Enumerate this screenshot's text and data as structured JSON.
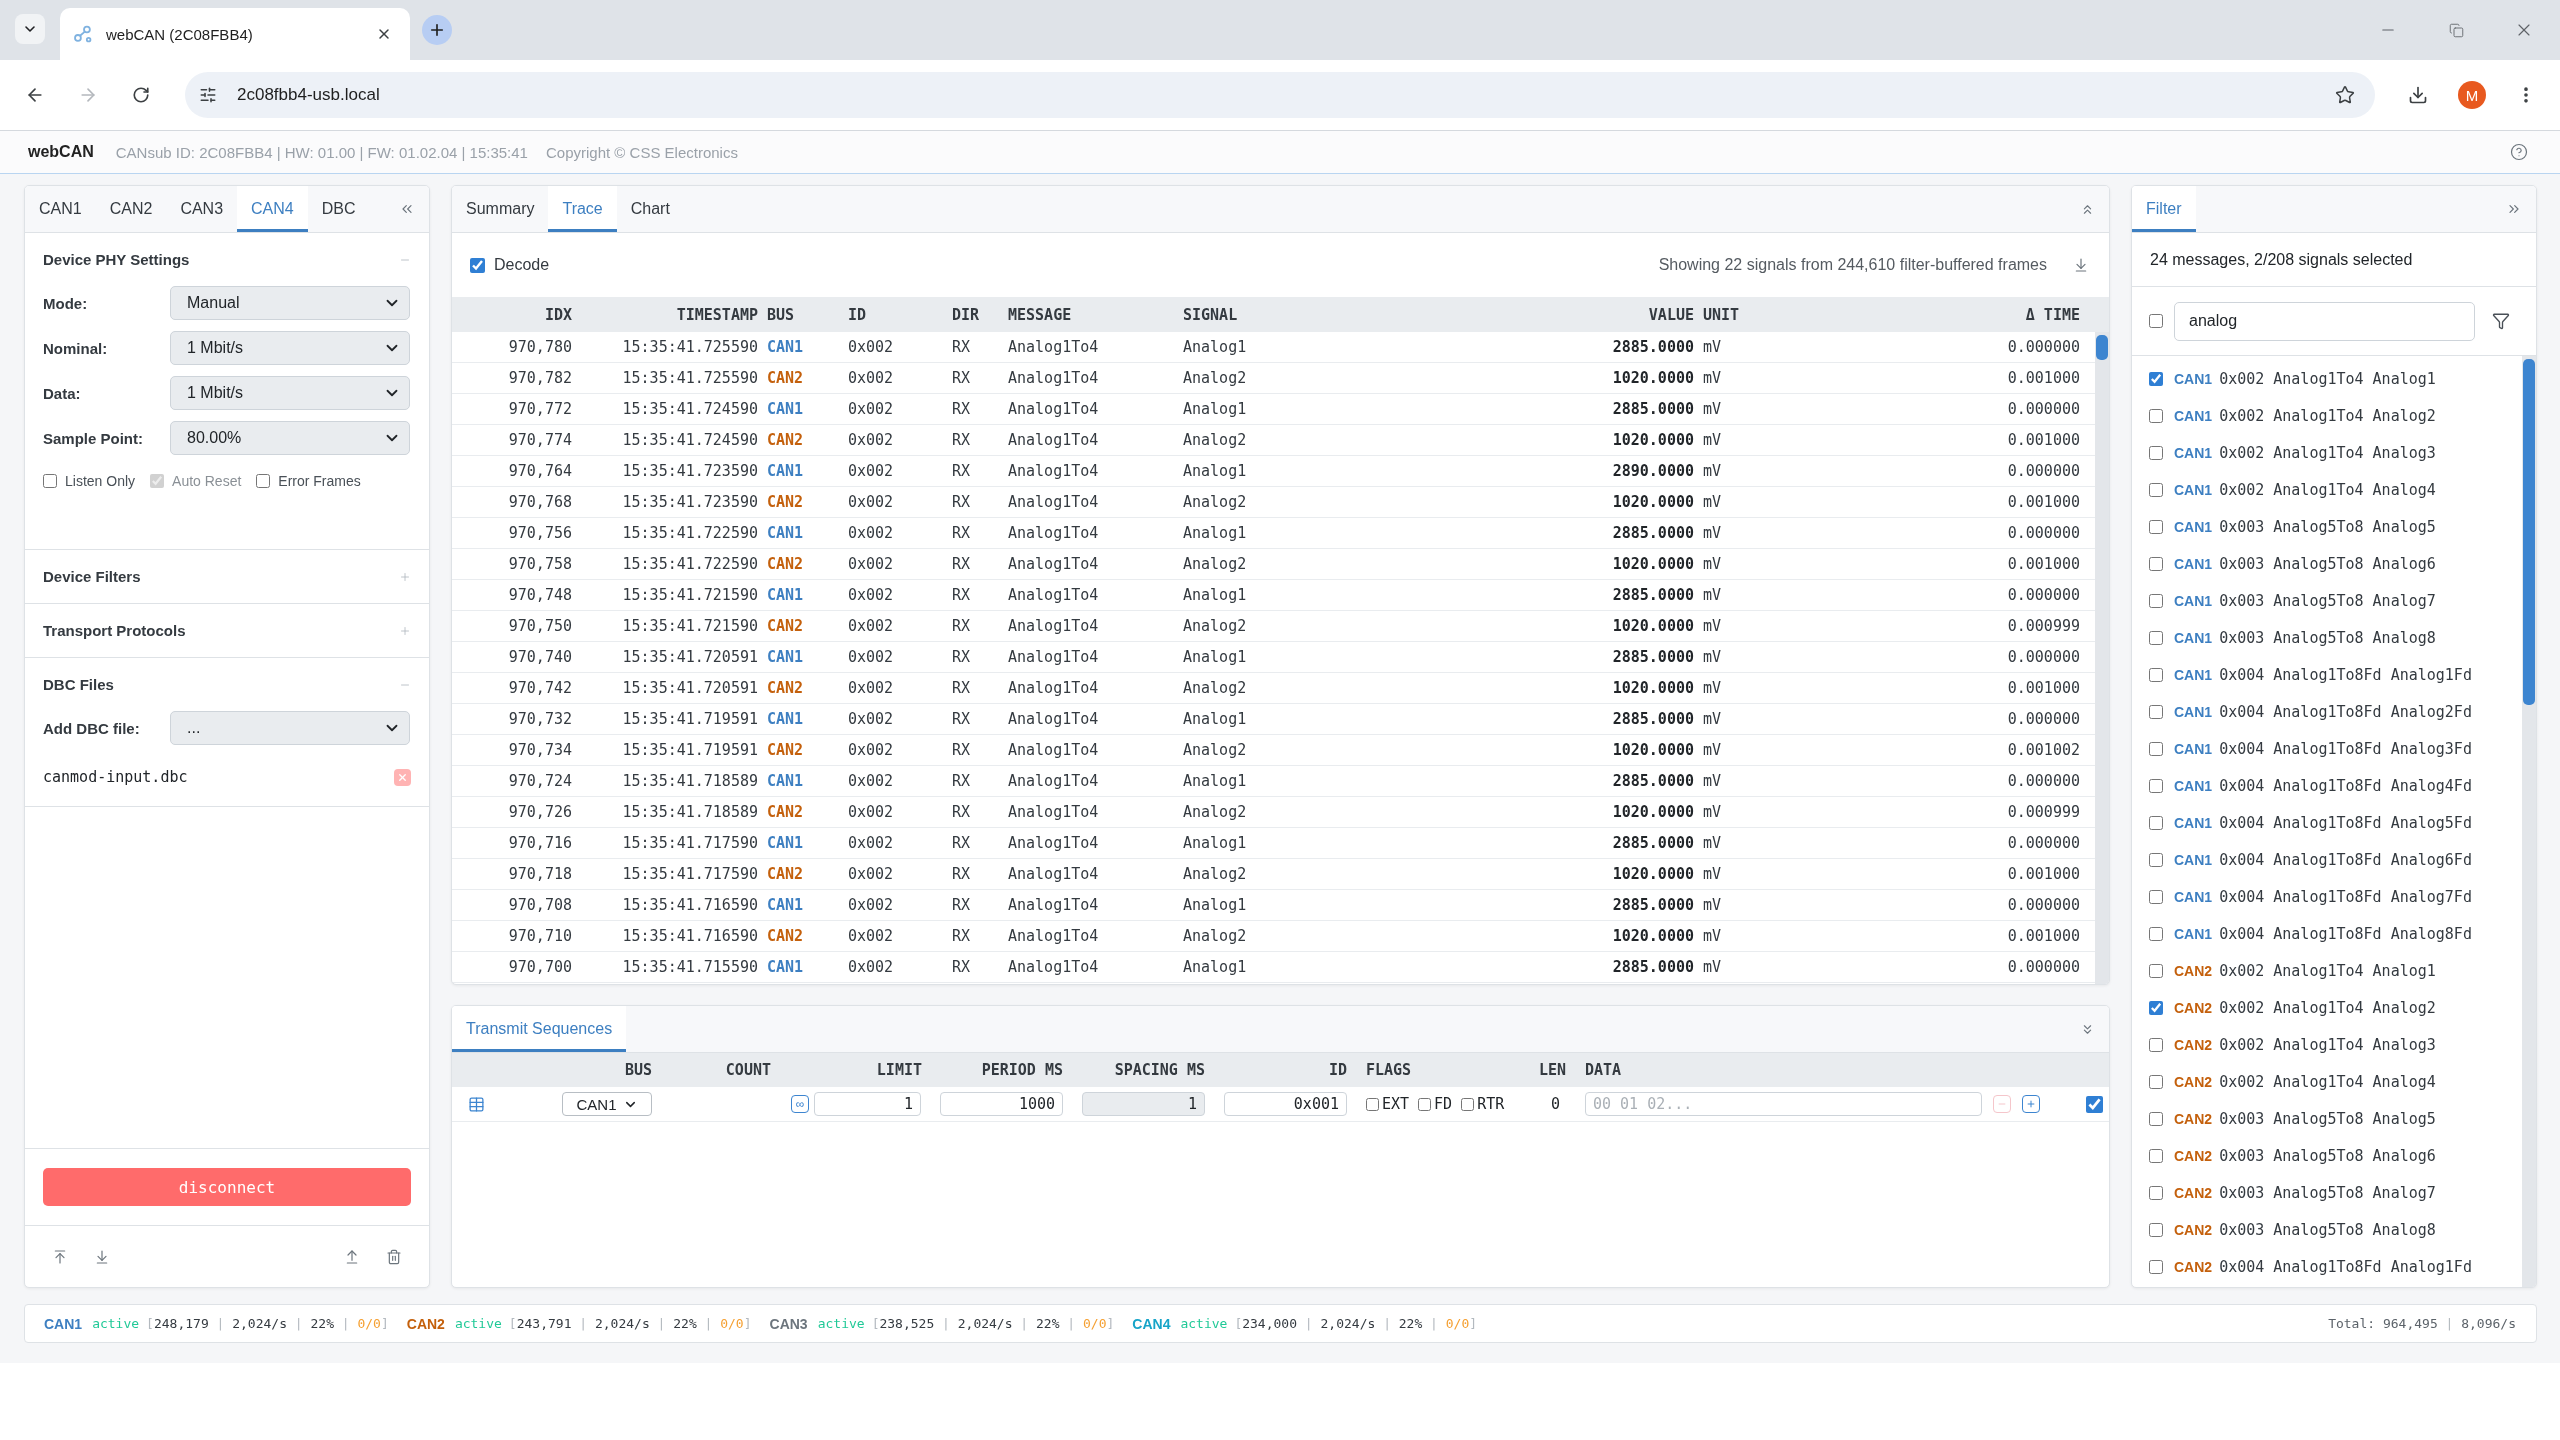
{
  "browser": {
    "tab_title": "webCAN (2C08FBB4)",
    "address": "2c08fbb4-usb.local",
    "profile_initial": "M"
  },
  "app_header": {
    "app_name": "webCAN",
    "device_info": "CANsub ID: 2C08FBB4 | HW: 01.00 | FW: 01.02.04 | 15:35:41",
    "copyright": "Copyright © CSS Electronics"
  },
  "device_panel": {
    "tabs": [
      {
        "label": "CAN1",
        "selected": false
      },
      {
        "label": "CAN2",
        "selected": false
      },
      {
        "label": "CAN3",
        "selected": false
      },
      {
        "label": "CAN4",
        "selected": true
      },
      {
        "label": "DBC",
        "selected": false
      }
    ],
    "sections": [
      {
        "title": "Device PHY Settings",
        "expanded": true,
        "fields": [
          {
            "label": "Mode:",
            "value": "Manual"
          },
          {
            "label": "Nominal:",
            "value": "1 Mbit/s"
          },
          {
            "label": "Data:",
            "value": "1 Mbit/s"
          },
          {
            "label": "Sample Point:",
            "value": "80.00%"
          }
        ],
        "options": [
          {
            "label": "Listen Only",
            "checked": false,
            "disabled": false
          },
          {
            "label": "Auto Reset",
            "checked": true,
            "disabled": true
          },
          {
            "label": "Error Frames",
            "checked": false,
            "disabled": false
          }
        ]
      },
      {
        "title": "Device Filters",
        "expanded": false
      },
      {
        "title": "Transport Protocols",
        "expanded": false
      },
      {
        "title": "DBC Files",
        "expanded": true,
        "fields": [
          {
            "label": "Add DBC file:",
            "value": "..."
          }
        ],
        "files": [
          "canmod-input.dbc"
        ]
      }
    ],
    "disconnect_button": "disconnect"
  },
  "trace_panel": {
    "tabs": [
      {
        "label": "Summary",
        "selected": false
      },
      {
        "label": "Trace",
        "selected": true
      },
      {
        "label": "Chart",
        "selected": false
      }
    ],
    "decode": {
      "label": "Decode",
      "checked": true
    },
    "summary": "Showing 22 signals from 244,610 filter-buffered frames",
    "columns": [
      "IDX",
      "TIMESTAMP",
      "BUS",
      "ID",
      "DIR",
      "MESSAGE",
      "SIGNAL",
      "VALUE",
      "UNIT",
      "Δ TIME"
    ],
    "rows": [
      {
        "idx": "970,780",
        "timestamp": "15:35:41.725590",
        "bus": {
          "label": "CAN1",
          "color": "#3d7fc1"
        },
        "id": "0x002",
        "dir": "RX",
        "message": "Analog1To4",
        "signal": "Analog1",
        "value": "2885.0000",
        "unit": "mV",
        "delta_time": "0.000000"
      },
      {
        "idx": "970,782",
        "timestamp": "15:35:41.725590",
        "bus": {
          "label": "CAN2",
          "color": "#c4600c"
        },
        "id": "0x002",
        "dir": "RX",
        "message": "Analog1To4",
        "signal": "Analog2",
        "value": "1020.0000",
        "unit": "mV",
        "delta_time": "0.001000"
      },
      {
        "idx": "970,772",
        "timestamp": "15:35:41.724590",
        "bus": {
          "label": "CAN1",
          "color": "#3d7fc1"
        },
        "id": "0x002",
        "dir": "RX",
        "message": "Analog1To4",
        "signal": "Analog1",
        "value": "2885.0000",
        "unit": "mV",
        "delta_time": "0.000000"
      },
      {
        "idx": "970,774",
        "timestamp": "15:35:41.724590",
        "bus": {
          "label": "CAN2",
          "color": "#c4600c"
        },
        "id": "0x002",
        "dir": "RX",
        "message": "Analog1To4",
        "signal": "Analog2",
        "value": "1020.0000",
        "unit": "mV",
        "delta_time": "0.001000"
      },
      {
        "idx": "970,764",
        "timestamp": "15:35:41.723590",
        "bus": {
          "label": "CAN1",
          "color": "#3d7fc1"
        },
        "id": "0x002",
        "dir": "RX",
        "message": "Analog1To4",
        "signal": "Analog1",
        "value": "2890.0000",
        "unit": "mV",
        "delta_time": "0.000000"
      },
      {
        "idx": "970,768",
        "timestamp": "15:35:41.723590",
        "bus": {
          "label": "CAN2",
          "color": "#c4600c"
        },
        "id": "0x002",
        "dir": "RX",
        "message": "Analog1To4",
        "signal": "Analog2",
        "value": "1020.0000",
        "unit": "mV",
        "delta_time": "0.001000"
      },
      {
        "idx": "970,756",
        "timestamp": "15:35:41.722590",
        "bus": {
          "label": "CAN1",
          "color": "#3d7fc1"
        },
        "id": "0x002",
        "dir": "RX",
        "message": "Analog1To4",
        "signal": "Analog1",
        "value": "2885.0000",
        "unit": "mV",
        "delta_time": "0.000000"
      },
      {
        "idx": "970,758",
        "timestamp": "15:35:41.722590",
        "bus": {
          "label": "CAN2",
          "color": "#c4600c"
        },
        "id": "0x002",
        "dir": "RX",
        "message": "Analog1To4",
        "signal": "Analog2",
        "value": "1020.0000",
        "unit": "mV",
        "delta_time": "0.001000"
      },
      {
        "idx": "970,748",
        "timestamp": "15:35:41.721590",
        "bus": {
          "label": "CAN1",
          "color": "#3d7fc1"
        },
        "id": "0x002",
        "dir": "RX",
        "message": "Analog1To4",
        "signal": "Analog1",
        "value": "2885.0000",
        "unit": "mV",
        "delta_time": "0.000000"
      },
      {
        "idx": "970,750",
        "timestamp": "15:35:41.721590",
        "bus": {
          "label": "CAN2",
          "color": "#c4600c"
        },
        "id": "0x002",
        "dir": "RX",
        "message": "Analog1To4",
        "signal": "Analog2",
        "value": "1020.0000",
        "unit": "mV",
        "delta_time": "0.000999"
      },
      {
        "idx": "970,740",
        "timestamp": "15:35:41.720591",
        "bus": {
          "label": "CAN1",
          "color": "#3d7fc1"
        },
        "id": "0x002",
        "dir": "RX",
        "message": "Analog1To4",
        "signal": "Analog1",
        "value": "2885.0000",
        "unit": "mV",
        "delta_time": "0.000000"
      },
      {
        "idx": "970,742",
        "timestamp": "15:35:41.720591",
        "bus": {
          "label": "CAN2",
          "color": "#c4600c"
        },
        "id": "0x002",
        "dir": "RX",
        "message": "Analog1To4",
        "signal": "Analog2",
        "value": "1020.0000",
        "unit": "mV",
        "delta_time": "0.001000"
      },
      {
        "idx": "970,732",
        "timestamp": "15:35:41.719591",
        "bus": {
          "label": "CAN1",
          "color": "#3d7fc1"
        },
        "id": "0x002",
        "dir": "RX",
        "message": "Analog1To4",
        "signal": "Analog1",
        "value": "2885.0000",
        "unit": "mV",
        "delta_time": "0.000000"
      },
      {
        "idx": "970,734",
        "timestamp": "15:35:41.719591",
        "bus": {
          "label": "CAN2",
          "color": "#c4600c"
        },
        "id": "0x002",
        "dir": "RX",
        "message": "Analog1To4",
        "signal": "Analog2",
        "value": "1020.0000",
        "unit": "mV",
        "delta_time": "0.001002"
      },
      {
        "idx": "970,724",
        "timestamp": "15:35:41.718589",
        "bus": {
          "label": "CAN1",
          "color": "#3d7fc1"
        },
        "id": "0x002",
        "dir": "RX",
        "message": "Analog1To4",
        "signal": "Analog1",
        "value": "2885.0000",
        "unit": "mV",
        "delta_time": "0.000000"
      },
      {
        "idx": "970,726",
        "timestamp": "15:35:41.718589",
        "bus": {
          "label": "CAN2",
          "color": "#c4600c"
        },
        "id": "0x002",
        "dir": "RX",
        "message": "Analog1To4",
        "signal": "Analog2",
        "value": "1020.0000",
        "unit": "mV",
        "delta_time": "0.000999"
      },
      {
        "idx": "970,716",
        "timestamp": "15:35:41.717590",
        "bus": {
          "label": "CAN1",
          "color": "#3d7fc1"
        },
        "id": "0x002",
        "dir": "RX",
        "message": "Analog1To4",
        "signal": "Analog1",
        "value": "2885.0000",
        "unit": "mV",
        "delta_time": "0.000000"
      },
      {
        "idx": "970,718",
        "timestamp": "15:35:41.717590",
        "bus": {
          "label": "CAN2",
          "color": "#c4600c"
        },
        "id": "0x002",
        "dir": "RX",
        "message": "Analog1To4",
        "signal": "Analog2",
        "value": "1020.0000",
        "unit": "mV",
        "delta_time": "0.001000"
      },
      {
        "idx": "970,708",
        "timestamp": "15:35:41.716590",
        "bus": {
          "label": "CAN1",
          "color": "#3d7fc1"
        },
        "id": "0x002",
        "dir": "RX",
        "message": "Analog1To4",
        "signal": "Analog1",
        "value": "2885.0000",
        "unit": "mV",
        "delta_time": "0.000000"
      },
      {
        "idx": "970,710",
        "timestamp": "15:35:41.716590",
        "bus": {
          "label": "CAN2",
          "color": "#c4600c"
        },
        "id": "0x002",
        "dir": "RX",
        "message": "Analog1To4",
        "signal": "Analog2",
        "value": "1020.0000",
        "unit": "mV",
        "delta_time": "0.001000"
      },
      {
        "idx": "970,700",
        "timestamp": "15:35:41.715590",
        "bus": {
          "label": "CAN1",
          "color": "#3d7fc1"
        },
        "id": "0x002",
        "dir": "RX",
        "message": "Analog1To4",
        "signal": "Analog1",
        "value": "2885.0000",
        "unit": "mV",
        "delta_time": "0.000000"
      }
    ]
  },
  "transmit_panel": {
    "tabs": [
      {
        "label": "Transmit Sequences",
        "selected": true
      }
    ],
    "columns": [
      "BUS",
      "COUNT",
      "LIMIT",
      "PERIOD MS",
      "SPACING MS",
      "ID",
      "FLAGS",
      "LEN",
      "DATA"
    ],
    "rows": [
      {
        "bus": "CAN1",
        "limit_infinite_button": "∞",
        "limit": "1",
        "period_ms": "1000",
        "spacing_ms": {
          "value": "1",
          "disabled": true
        },
        "id": "0x001",
        "flags": [
          {
            "label": "EXT",
            "checked": false
          },
          {
            "label": "FD",
            "checked": false
          },
          {
            "label": "RTR",
            "checked": false
          }
        ],
        "len": "0",
        "data": {
          "placeholder": "00 01 02..."
        },
        "remove_disabled": true,
        "checked": true
      }
    ]
  },
  "filter_panel": {
    "tabs": [
      {
        "label": "Filter",
        "selected": true
      }
    ],
    "summary": "24 messages, 2/208 signals selected",
    "select_all": {
      "checked": false
    },
    "search": {
      "value": "analog"
    },
    "items": [
      {
        "bus": {
          "label": "CAN1",
          "color": "#3d7fc1"
        },
        "id": "0x002",
        "message": "Analog1To4",
        "signal": "Analog1",
        "checked": true
      },
      {
        "bus": {
          "label": "CAN1",
          "color": "#3d7fc1"
        },
        "id": "0x002",
        "message": "Analog1To4",
        "signal": "Analog2",
        "checked": false
      },
      {
        "bus": {
          "label": "CAN1",
          "color": "#3d7fc1"
        },
        "id": "0x002",
        "message": "Analog1To4",
        "signal": "Analog3",
        "checked": false
      },
      {
        "bus": {
          "label": "CAN1",
          "color": "#3d7fc1"
        },
        "id": "0x002",
        "message": "Analog1To4",
        "signal": "Analog4",
        "checked": false
      },
      {
        "bus": {
          "label": "CAN1",
          "color": "#3d7fc1"
        },
        "id": "0x003",
        "message": "Analog5To8",
        "signal": "Analog5",
        "checked": false
      },
      {
        "bus": {
          "label": "CAN1",
          "color": "#3d7fc1"
        },
        "id": "0x003",
        "message": "Analog5To8",
        "signal": "Analog6",
        "checked": false
      },
      {
        "bus": {
          "label": "CAN1",
          "color": "#3d7fc1"
        },
        "id": "0x003",
        "message": "Analog5To8",
        "signal": "Analog7",
        "checked": false
      },
      {
        "bus": {
          "label": "CAN1",
          "color": "#3d7fc1"
        },
        "id": "0x003",
        "message": "Analog5To8",
        "signal": "Analog8",
        "checked": false
      },
      {
        "bus": {
          "label": "CAN1",
          "color": "#3d7fc1"
        },
        "id": "0x004",
        "message": "Analog1To8Fd",
        "signal": "Analog1Fd",
        "checked": false
      },
      {
        "bus": {
          "label": "CAN1",
          "color": "#3d7fc1"
        },
        "id": "0x004",
        "message": "Analog1To8Fd",
        "signal": "Analog2Fd",
        "checked": false
      },
      {
        "bus": {
          "label": "CAN1",
          "color": "#3d7fc1"
        },
        "id": "0x004",
        "message": "Analog1To8Fd",
        "signal": "Analog3Fd",
        "checked": false
      },
      {
        "bus": {
          "label": "CAN1",
          "color": "#3d7fc1"
        },
        "id": "0x004",
        "message": "Analog1To8Fd",
        "signal": "Analog4Fd",
        "checked": false
      },
      {
        "bus": {
          "label": "CAN1",
          "color": "#3d7fc1"
        },
        "id": "0x004",
        "message": "Analog1To8Fd",
        "signal": "Analog5Fd",
        "checked": false
      },
      {
        "bus": {
          "label": "CAN1",
          "color": "#3d7fc1"
        },
        "id": "0x004",
        "message": "Analog1To8Fd",
        "signal": "Analog6Fd",
        "checked": false
      },
      {
        "bus": {
          "label": "CAN1",
          "color": "#3d7fc1"
        },
        "id": "0x004",
        "message": "Analog1To8Fd",
        "signal": "Analog7Fd",
        "checked": false
      },
      {
        "bus": {
          "label": "CAN1",
          "color": "#3d7fc1"
        },
        "id": "0x004",
        "message": "Analog1To8Fd",
        "signal": "Analog8Fd",
        "checked": false
      },
      {
        "bus": {
          "label": "CAN2",
          "color": "#c4600c"
        },
        "id": "0x002",
        "message": "Analog1To4",
        "signal": "Analog1",
        "checked": false
      },
      {
        "bus": {
          "label": "CAN2",
          "color": "#c4600c"
        },
        "id": "0x002",
        "message": "Analog1To4",
        "signal": "Analog2",
        "checked": true
      },
      {
        "bus": {
          "label": "CAN2",
          "color": "#c4600c"
        },
        "id": "0x002",
        "message": "Analog1To4",
        "signal": "Analog3",
        "checked": false
      },
      {
        "bus": {
          "label": "CAN2",
          "color": "#c4600c"
        },
        "id": "0x002",
        "message": "Analog1To4",
        "signal": "Analog4",
        "checked": false
      },
      {
        "bus": {
          "label": "CAN2",
          "color": "#c4600c"
        },
        "id": "0x003",
        "message": "Analog5To8",
        "signal": "Analog5",
        "checked": false
      },
      {
        "bus": {
          "label": "CAN2",
          "color": "#c4600c"
        },
        "id": "0x003",
        "message": "Analog5To8",
        "signal": "Analog6",
        "checked": false
      },
      {
        "bus": {
          "label": "CAN2",
          "color": "#c4600c"
        },
        "id": "0x003",
        "message": "Analog5To8",
        "signal": "Analog7",
        "checked": false
      },
      {
        "bus": {
          "label": "CAN2",
          "color": "#c4600c"
        },
        "id": "0x003",
        "message": "Analog5To8",
        "signal": "Analog8",
        "checked": false
      },
      {
        "bus": {
          "label": "CAN2",
          "color": "#c4600c"
        },
        "id": "0x004",
        "message": "Analog1To8Fd",
        "signal": "Analog1Fd",
        "checked": false
      }
    ]
  },
  "status_bar": {
    "buses": [
      {
        "label": "CAN1",
        "color": "#3d7fc1",
        "state": "active",
        "stats": "[248,179 | 2,024/s | 22% | 0/0]"
      },
      {
        "label": "CAN2",
        "color": "#c4600c",
        "state": "active",
        "stats": "[243,791 | 2,024/s | 22% | 0/0]"
      },
      {
        "label": "CAN3",
        "color": "#6c757d",
        "state": "active",
        "stats": "[238,525 | 2,024/s | 22% | 0/0]"
      },
      {
        "label": "CAN4",
        "color": "#17a4c8",
        "state": "active",
        "stats": "[234,000 | 2,024/s | 22% | 0/0]"
      }
    ],
    "total": "Total: 964,495 | 8,096/s"
  }
}
